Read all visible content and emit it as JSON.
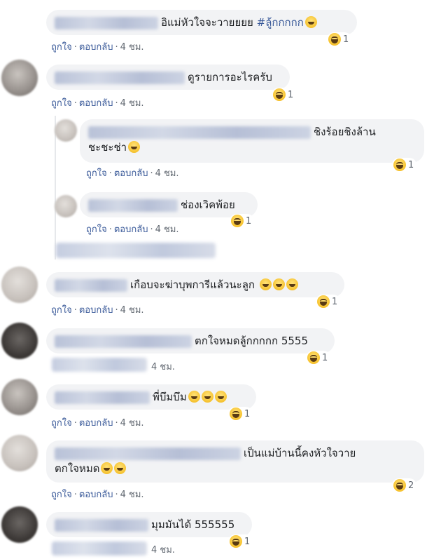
{
  "actions": {
    "like": "ถูกใจ",
    "reply": "ตอบกลับ",
    "sep": "·"
  },
  "comments": [
    {
      "text": "อิแม่หัวใจจะวายยยย",
      "hashtag": "#ลู้กกกกก",
      "time": "4 ชม.",
      "reactions": "1"
    },
    {
      "text": "ดูรายการอะไรครับ",
      "time": "4 ชม.",
      "reactions": "1"
    },
    {
      "line1": "ชิงร้อยชิงล้าน",
      "line2": "ชะชะช่า",
      "time": "4 ชม.",
      "reactions": "1"
    },
    {
      "text": "ช่องเวิคพ้อย",
      "time": "4 ชม.",
      "reactions": "1"
    },
    {
      "text": "เกือบจะฆ่าบุพการีแล้วนะลูก",
      "time": "4 ชม.",
      "reactions": "1"
    },
    {
      "text": "ตกใจหมดลู้กกกกก 5555",
      "time": "4 ชม.",
      "reactions": "1"
    },
    {
      "text": "พี่บึมบึม",
      "time": "4 ชม.",
      "reactions": "1"
    },
    {
      "line1": "เป็นแม่บ้านนี้คงหัวใจวาย",
      "line2": "ตกใจหมด",
      "time": "4 ชม.",
      "reactions": "2"
    },
    {
      "text": "มุมมันได้ 555555",
      "time": "4 ชม.",
      "reactions": "1"
    }
  ],
  "icons": {
    "reaction": "haha-icon",
    "emoji": "grinning-emoji"
  },
  "colors": {
    "bubble": "#f2f3f5",
    "link": "#385898",
    "meta": "#606770"
  }
}
